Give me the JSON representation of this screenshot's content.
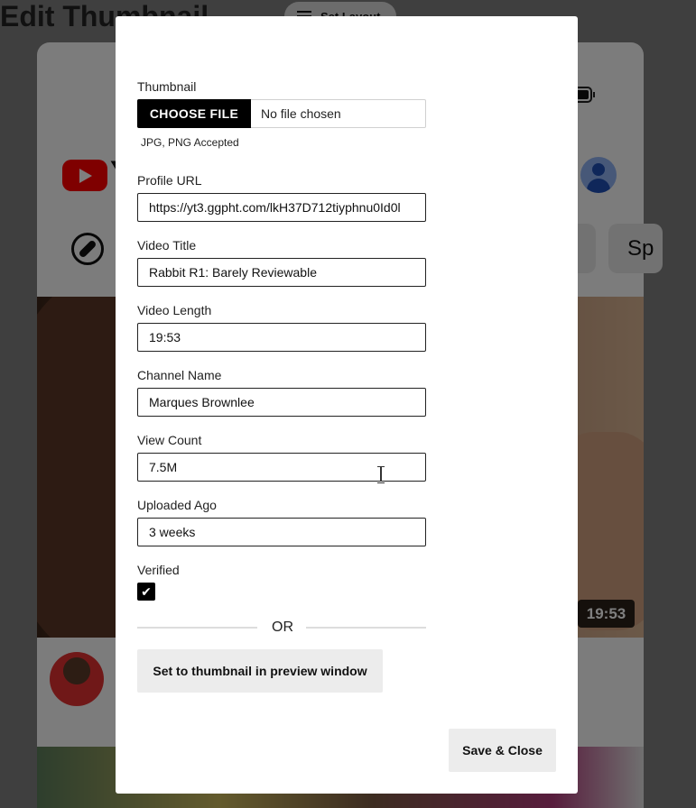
{
  "background": {
    "layout_button_label": "Set Layout",
    "logo_fragment": "Y",
    "chip_labels": [
      "",
      "Sp"
    ],
    "video_duration": "19:53"
  },
  "modal": {
    "title": "Edit Thumbnail",
    "thumbnail": {
      "label": "Thumbnail",
      "choose_file_label": "CHOOSE FILE",
      "file_status": "No file chosen",
      "hint": "JPG, PNG Accepted"
    },
    "profile_url": {
      "label": "Profile URL",
      "value": "https://yt3.ggpht.com/lkH37D712tiyphnu0Id0l"
    },
    "video_title": {
      "label": "Video Title",
      "value": "Rabbit R1: Barely Reviewable"
    },
    "video_length": {
      "label": "Video Length",
      "value": "19:53"
    },
    "channel_name": {
      "label": "Channel Name",
      "value": "Marques Brownlee"
    },
    "view_count": {
      "label": "View Count",
      "value": "7.5M"
    },
    "uploaded_ago": {
      "label": "Uploaded Ago",
      "value": "3 weeks"
    },
    "verified": {
      "label": "Verified",
      "checked": true,
      "check_glyph": "✔"
    },
    "or_label": "OR",
    "preview_button_label": "Set to thumbnail in preview window",
    "save_button_label": "Save & Close"
  }
}
